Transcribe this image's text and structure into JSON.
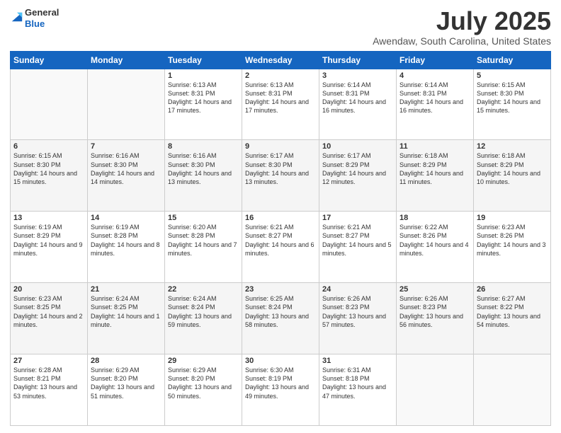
{
  "logo": {
    "general": "General",
    "blue": "Blue"
  },
  "header": {
    "title": "July 2025",
    "location": "Awendaw, South Carolina, United States"
  },
  "weekdays": [
    "Sunday",
    "Monday",
    "Tuesday",
    "Wednesday",
    "Thursday",
    "Friday",
    "Saturday"
  ],
  "weeks": [
    [
      {
        "day": "",
        "sunrise": "",
        "sunset": "",
        "daylight": ""
      },
      {
        "day": "",
        "sunrise": "",
        "sunset": "",
        "daylight": ""
      },
      {
        "day": "1",
        "sunrise": "Sunrise: 6:13 AM",
        "sunset": "Sunset: 8:31 PM",
        "daylight": "Daylight: 14 hours and 17 minutes."
      },
      {
        "day": "2",
        "sunrise": "Sunrise: 6:13 AM",
        "sunset": "Sunset: 8:31 PM",
        "daylight": "Daylight: 14 hours and 17 minutes."
      },
      {
        "day": "3",
        "sunrise": "Sunrise: 6:14 AM",
        "sunset": "Sunset: 8:31 PM",
        "daylight": "Daylight: 14 hours and 16 minutes."
      },
      {
        "day": "4",
        "sunrise": "Sunrise: 6:14 AM",
        "sunset": "Sunset: 8:31 PM",
        "daylight": "Daylight: 14 hours and 16 minutes."
      },
      {
        "day": "5",
        "sunrise": "Sunrise: 6:15 AM",
        "sunset": "Sunset: 8:30 PM",
        "daylight": "Daylight: 14 hours and 15 minutes."
      }
    ],
    [
      {
        "day": "6",
        "sunrise": "Sunrise: 6:15 AM",
        "sunset": "Sunset: 8:30 PM",
        "daylight": "Daylight: 14 hours and 15 minutes."
      },
      {
        "day": "7",
        "sunrise": "Sunrise: 6:16 AM",
        "sunset": "Sunset: 8:30 PM",
        "daylight": "Daylight: 14 hours and 14 minutes."
      },
      {
        "day": "8",
        "sunrise": "Sunrise: 6:16 AM",
        "sunset": "Sunset: 8:30 PM",
        "daylight": "Daylight: 14 hours and 13 minutes."
      },
      {
        "day": "9",
        "sunrise": "Sunrise: 6:17 AM",
        "sunset": "Sunset: 8:30 PM",
        "daylight": "Daylight: 14 hours and 13 minutes."
      },
      {
        "day": "10",
        "sunrise": "Sunrise: 6:17 AM",
        "sunset": "Sunset: 8:29 PM",
        "daylight": "Daylight: 14 hours and 12 minutes."
      },
      {
        "day": "11",
        "sunrise": "Sunrise: 6:18 AM",
        "sunset": "Sunset: 8:29 PM",
        "daylight": "Daylight: 14 hours and 11 minutes."
      },
      {
        "day": "12",
        "sunrise": "Sunrise: 6:18 AM",
        "sunset": "Sunset: 8:29 PM",
        "daylight": "Daylight: 14 hours and 10 minutes."
      }
    ],
    [
      {
        "day": "13",
        "sunrise": "Sunrise: 6:19 AM",
        "sunset": "Sunset: 8:29 PM",
        "daylight": "Daylight: 14 hours and 9 minutes."
      },
      {
        "day": "14",
        "sunrise": "Sunrise: 6:19 AM",
        "sunset": "Sunset: 8:28 PM",
        "daylight": "Daylight: 14 hours and 8 minutes."
      },
      {
        "day": "15",
        "sunrise": "Sunrise: 6:20 AM",
        "sunset": "Sunset: 8:28 PM",
        "daylight": "Daylight: 14 hours and 7 minutes."
      },
      {
        "day": "16",
        "sunrise": "Sunrise: 6:21 AM",
        "sunset": "Sunset: 8:27 PM",
        "daylight": "Daylight: 14 hours and 6 minutes."
      },
      {
        "day": "17",
        "sunrise": "Sunrise: 6:21 AM",
        "sunset": "Sunset: 8:27 PM",
        "daylight": "Daylight: 14 hours and 5 minutes."
      },
      {
        "day": "18",
        "sunrise": "Sunrise: 6:22 AM",
        "sunset": "Sunset: 8:26 PM",
        "daylight": "Daylight: 14 hours and 4 minutes."
      },
      {
        "day": "19",
        "sunrise": "Sunrise: 6:23 AM",
        "sunset": "Sunset: 8:26 PM",
        "daylight": "Daylight: 14 hours and 3 minutes."
      }
    ],
    [
      {
        "day": "20",
        "sunrise": "Sunrise: 6:23 AM",
        "sunset": "Sunset: 8:25 PM",
        "daylight": "Daylight: 14 hours and 2 minutes."
      },
      {
        "day": "21",
        "sunrise": "Sunrise: 6:24 AM",
        "sunset": "Sunset: 8:25 PM",
        "daylight": "Daylight: 14 hours and 1 minute."
      },
      {
        "day": "22",
        "sunrise": "Sunrise: 6:24 AM",
        "sunset": "Sunset: 8:24 PM",
        "daylight": "Daylight: 13 hours and 59 minutes."
      },
      {
        "day": "23",
        "sunrise": "Sunrise: 6:25 AM",
        "sunset": "Sunset: 8:24 PM",
        "daylight": "Daylight: 13 hours and 58 minutes."
      },
      {
        "day": "24",
        "sunrise": "Sunrise: 6:26 AM",
        "sunset": "Sunset: 8:23 PM",
        "daylight": "Daylight: 13 hours and 57 minutes."
      },
      {
        "day": "25",
        "sunrise": "Sunrise: 6:26 AM",
        "sunset": "Sunset: 8:23 PM",
        "daylight": "Daylight: 13 hours and 56 minutes."
      },
      {
        "day": "26",
        "sunrise": "Sunrise: 6:27 AM",
        "sunset": "Sunset: 8:22 PM",
        "daylight": "Daylight: 13 hours and 54 minutes."
      }
    ],
    [
      {
        "day": "27",
        "sunrise": "Sunrise: 6:28 AM",
        "sunset": "Sunset: 8:21 PM",
        "daylight": "Daylight: 13 hours and 53 minutes."
      },
      {
        "day": "28",
        "sunrise": "Sunrise: 6:29 AM",
        "sunset": "Sunset: 8:20 PM",
        "daylight": "Daylight: 13 hours and 51 minutes."
      },
      {
        "day": "29",
        "sunrise": "Sunrise: 6:29 AM",
        "sunset": "Sunset: 8:20 PM",
        "daylight": "Daylight: 13 hours and 50 minutes."
      },
      {
        "day": "30",
        "sunrise": "Sunrise: 6:30 AM",
        "sunset": "Sunset: 8:19 PM",
        "daylight": "Daylight: 13 hours and 49 minutes."
      },
      {
        "day": "31",
        "sunrise": "Sunrise: 6:31 AM",
        "sunset": "Sunset: 8:18 PM",
        "daylight": "Daylight: 13 hours and 47 minutes."
      },
      {
        "day": "",
        "sunrise": "",
        "sunset": "",
        "daylight": ""
      },
      {
        "day": "",
        "sunrise": "",
        "sunset": "",
        "daylight": ""
      }
    ]
  ]
}
